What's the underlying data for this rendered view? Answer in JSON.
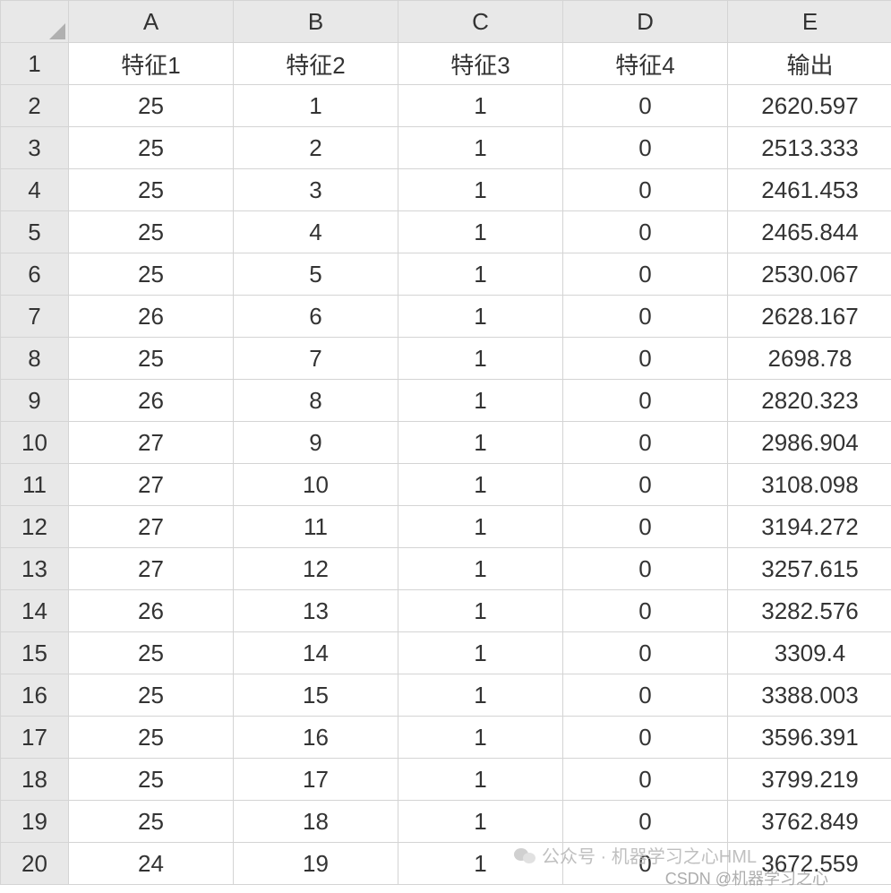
{
  "columns": [
    "A",
    "B",
    "C",
    "D",
    "E"
  ],
  "rowNumbers": [
    "1",
    "2",
    "3",
    "4",
    "5",
    "6",
    "7",
    "8",
    "9",
    "10",
    "11",
    "12",
    "13",
    "14",
    "15",
    "16",
    "17",
    "18",
    "19",
    "20"
  ],
  "headerRow": [
    "特征1",
    "特征2",
    "特征3",
    "特征4",
    "输出"
  ],
  "rows": [
    [
      "25",
      "1",
      "1",
      "0",
      "2620.597"
    ],
    [
      "25",
      "2",
      "1",
      "0",
      "2513.333"
    ],
    [
      "25",
      "3",
      "1",
      "0",
      "2461.453"
    ],
    [
      "25",
      "4",
      "1",
      "0",
      "2465.844"
    ],
    [
      "25",
      "5",
      "1",
      "0",
      "2530.067"
    ],
    [
      "26",
      "6",
      "1",
      "0",
      "2628.167"
    ],
    [
      "25",
      "7",
      "1",
      "0",
      "2698.78"
    ],
    [
      "26",
      "8",
      "1",
      "0",
      "2820.323"
    ],
    [
      "27",
      "9",
      "1",
      "0",
      "2986.904"
    ],
    [
      "27",
      "10",
      "1",
      "0",
      "3108.098"
    ],
    [
      "27",
      "11",
      "1",
      "0",
      "3194.272"
    ],
    [
      "27",
      "12",
      "1",
      "0",
      "3257.615"
    ],
    [
      "26",
      "13",
      "1",
      "0",
      "3282.576"
    ],
    [
      "25",
      "14",
      "1",
      "0",
      "3309.4"
    ],
    [
      "25",
      "15",
      "1",
      "0",
      "3388.003"
    ],
    [
      "25",
      "16",
      "1",
      "0",
      "3596.391"
    ],
    [
      "25",
      "17",
      "1",
      "0",
      "3799.219"
    ],
    [
      "25",
      "18",
      "1",
      "0",
      "3762.849"
    ],
    [
      "24",
      "19",
      "1",
      "0",
      "3672.559"
    ]
  ],
  "watermark": {
    "label1": "公众号 · 机器学习之心HML",
    "label2": "CSDN @机器学习之心"
  }
}
